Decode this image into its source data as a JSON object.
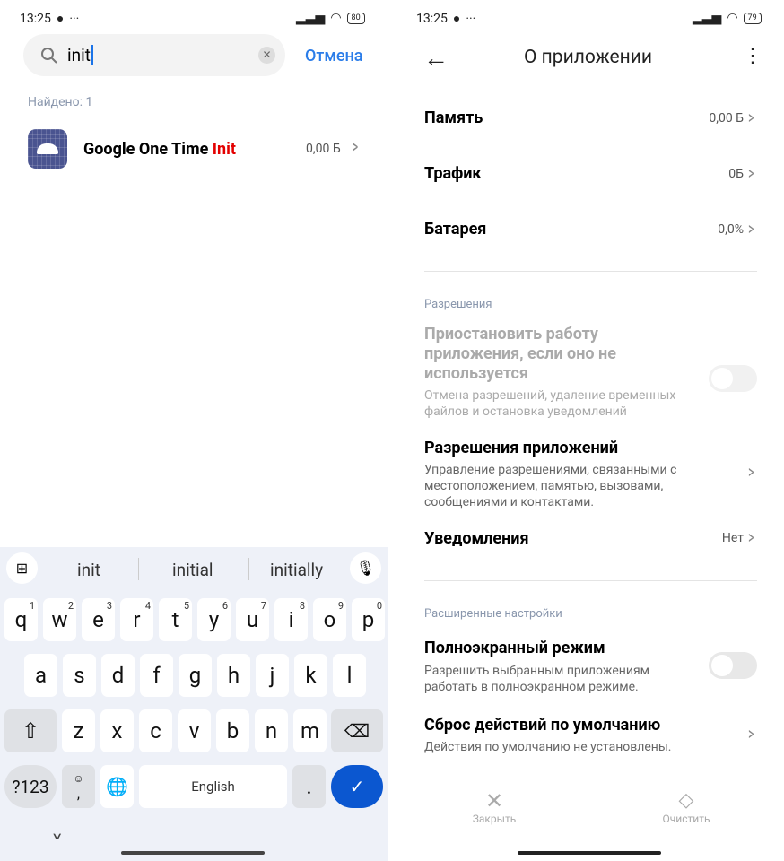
{
  "left": {
    "status": {
      "time": "13:25",
      "battery": "80"
    },
    "search": {
      "value": "init",
      "cancel": "Отмена"
    },
    "found": "Найдено: 1",
    "result": {
      "name": "Google One Time ",
      "highlight": "Init",
      "size": "0,00 Б"
    },
    "keyboard": {
      "suggestions": [
        "init",
        "initial",
        "initially"
      ],
      "row1": [
        [
          "q",
          "1"
        ],
        [
          "w",
          "2"
        ],
        [
          "e",
          "3"
        ],
        [
          "r",
          "4"
        ],
        [
          "t",
          "5"
        ],
        [
          "y",
          "6"
        ],
        [
          "u",
          "7"
        ],
        [
          "i",
          "8"
        ],
        [
          "o",
          "9"
        ],
        [
          "p",
          "0"
        ]
      ],
      "row2": [
        "a",
        "s",
        "d",
        "f",
        "g",
        "h",
        "j",
        "k",
        "l"
      ],
      "row3": [
        "z",
        "x",
        "c",
        "v",
        "b",
        "n",
        "m"
      ],
      "symbols": "?123",
      "comma": ",",
      "space": "English",
      "period": ".",
      "accent": "#0b57d0"
    }
  },
  "right": {
    "status": {
      "time": "13:25",
      "battery": "79"
    },
    "title": "О приложении",
    "memory": {
      "label": "Память",
      "value": "0,00 Б"
    },
    "traffic": {
      "label": "Трафик",
      "value": "0Б"
    },
    "battery": {
      "label": "Батарея",
      "value": "0,0%"
    },
    "permissions_header": "Разрешения",
    "pause": {
      "title": "Приостановить работу приложения, если оно не используется",
      "desc": "Отмена разрешений, удаление временных файлов и остановка уведомлений",
      "enabled": false
    },
    "app_perms": {
      "title": "Разрешения приложений",
      "desc": "Управление разрешениями, связанными с местоположением, памятью, вызовами, сообщениями и контактами."
    },
    "notifications": {
      "label": "Уведомления",
      "value": "Нет"
    },
    "advanced_header": "Расширенные настройки",
    "fullscreen": {
      "title": "Полноэкранный режим",
      "desc": "Разрешить выбранным приложениям работать в полноэкранном режиме.",
      "enabled": false
    },
    "reset": {
      "title": "Сброс действий по умолчанию",
      "desc": "Действия по умолчанию не установлены."
    },
    "close": "Закрыть",
    "clear": "Очистить"
  }
}
